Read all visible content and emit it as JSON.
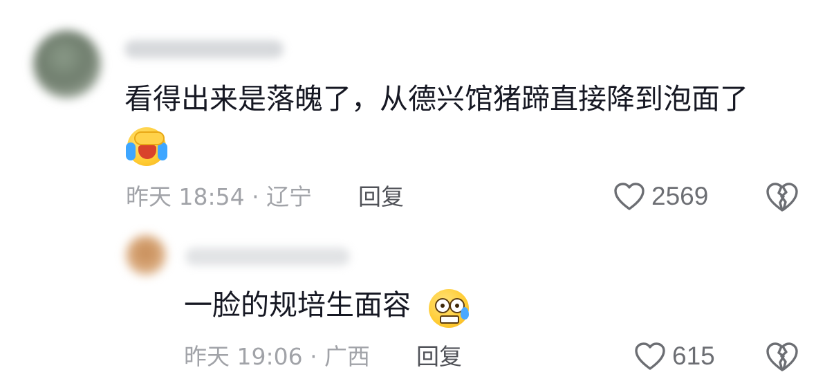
{
  "comments": [
    {
      "text": "看得出来是落魄了，从德兴馆猪蹄直接降到泡面了",
      "emoji": "face-with-tears-of-joy-covering",
      "time_location": "昨天 18:54 · 辽宁",
      "reply_label": "回复",
      "likes": "2569"
    },
    {
      "text": "一脸的规培生面容",
      "emoji": "flushed-face-with-sweat",
      "time_location": "昨天 19:06 · 广西",
      "reply_label": "回复",
      "likes": "615"
    }
  ],
  "colors": {
    "text_primary": "#161823",
    "text_meta": "#a1a3a8",
    "reply_label": "#505258",
    "icon_gray": "#6c6e73"
  },
  "icons": {
    "like": "heart-outline-icon",
    "dislike": "broken-heart-icon"
  }
}
